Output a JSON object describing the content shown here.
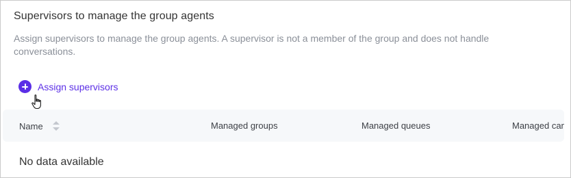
{
  "section": {
    "title": "Supervisors to manage the group agents",
    "description": "Assign supervisors to manage the group agents. A supervisor is not a member of the group and does not handle conversations."
  },
  "actions": {
    "assign_label": "Assign supervisors",
    "assign_icon": "plus-circle-icon",
    "accent_color": "#5b2ee6"
  },
  "table": {
    "columns": [
      "Name",
      "Managed groups",
      "Managed queues",
      "Managed cam"
    ],
    "empty_text": "No data available",
    "header_bg": "#f6f8fa"
  },
  "cursor": {
    "icon": "hand-pointer-icon"
  }
}
